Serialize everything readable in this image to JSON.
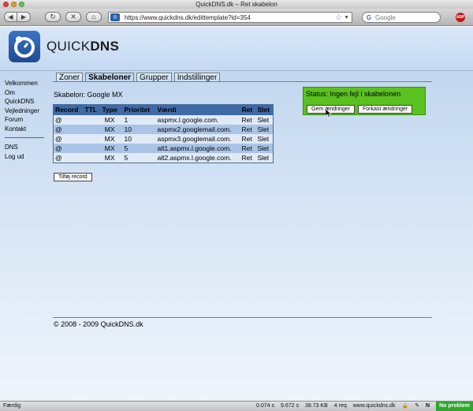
{
  "browser": {
    "window_title": "QuickDNS.dk – Ret skabelon",
    "url": "https://www.quickdns.dk/edittemplate?id=354",
    "search_placeholder": "Google",
    "search_engine_letter": "G",
    "adblock_label": "ABP"
  },
  "header": {
    "logo_text_light": "QUICK",
    "logo_text_bold": "DNS"
  },
  "sidebar": {
    "items": [
      "Velkommen",
      "Om QuickDNS",
      "Vejledninger",
      "Forum",
      "Kontakt"
    ],
    "items2": [
      "DNS",
      "Log ud"
    ]
  },
  "tabs": [
    "Zoner",
    "Skabeloner",
    "Grupper",
    "Indstillinger"
  ],
  "template_title": "Skabelon: Google MX",
  "table": {
    "headers": [
      "Record",
      "TTL",
      "Type",
      "Prioritet",
      "Værdi",
      "Ret",
      "Slet"
    ],
    "rows": [
      [
        "@",
        "",
        "MX",
        "1",
        "aspmx.l.google.com.",
        "Ret",
        "Slet"
      ],
      [
        "@",
        "",
        "MX",
        "10",
        "aspmx2.googlemail.com.",
        "Ret",
        "Slet"
      ],
      [
        "@",
        "",
        "MX",
        "10",
        "aspmx3.googlemail.com.",
        "Ret",
        "Slet"
      ],
      [
        "@",
        "",
        "MX",
        "5",
        "alt1.aspmx.l.google.com.",
        "Ret",
        "Slet"
      ],
      [
        "@",
        "",
        "MX",
        "5",
        "alt2.aspmx.l.google.com.",
        "Ret",
        "Slet"
      ]
    ]
  },
  "add_record_label": "Tilføj record",
  "status": {
    "message": "Status: Ingen fejl i skabelonen",
    "save_label": "Gem ændringer",
    "discard_label": "Forkast ændringer"
  },
  "footer": "© 2008 - 2009 QuickDNS.dk",
  "statusbar": {
    "left": "Færdig",
    "time1": "0.074 s",
    "time2": "9.672 s",
    "size": "38.73 KB",
    "requests": "4 req",
    "domain": "www.quickdns.dk",
    "ok": "No problem"
  },
  "colors": {
    "status_green": "#5ac21e",
    "table_header": "#3e6aa6",
    "row_dark": "#a9c4e6",
    "row_light": "#e0eaf7"
  }
}
